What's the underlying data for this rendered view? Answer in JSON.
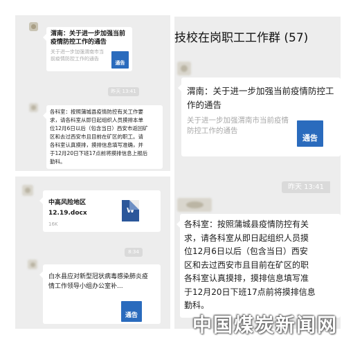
{
  "left_top": {
    "share_card": {
      "title": "渭南：关于进一步加强当前疫情防控工作的通告",
      "description": "关于进一步加强渭南市当前疫情防控工作的通告",
      "thumb_label": "通告"
    },
    "time_label": "昨天 13:41",
    "text_message": "各科室：按照蒲城县疫情防控有关工作要\n求，请各科室从即日起组织人员摸排本单\n位12月6日以后（包含当日）西安市返回矿\n区和去过西安市且目前在矿区的职工。请\n各科室认真摸排，摸排信息填写准确，并\n于12月20日下班17点前将摸排信息上报后\n勤科。"
  },
  "left_bottom": {
    "file_card": {
      "name": "中高风险地区\n12.19.docx",
      "size": "16K",
      "icon_label": "W"
    },
    "time_label": "8:34",
    "share_card": {
      "title": "白水县应对新型冠状病毒感染肺炎疫情工作领导小组办公室补...",
      "thumb_label": "通告"
    }
  },
  "right": {
    "group_title": "技校在岗职工工作群 (57)",
    "share_card": {
      "title": "渭南：关于进一步加强当前疫情防控工作的通告",
      "description": "关于进一步加强渭南市当前疫情防控工作的通告",
      "thumb_label": "通告"
    },
    "time_label": "昨天 13:41",
    "text_message": "各科室：按照蒲城县疫情防控有关\n求，请各科室从即日起组织人员摸\n位12月6日以后（包含当日）西安\n区和去过西安市且目前在矿区的职\n各科室认真摸排，摸排信息填写准\n于12月20日下班17点前将摸排信息\n勤科。"
  },
  "watermark": "中国煤炭新闻网",
  "colors": {
    "chat_background": "#ededed",
    "bubble": "#ffffff",
    "notice_blue": "#2a6bbd",
    "word_blue": "#2b579a",
    "muted_text": "#a8a8a8"
  }
}
